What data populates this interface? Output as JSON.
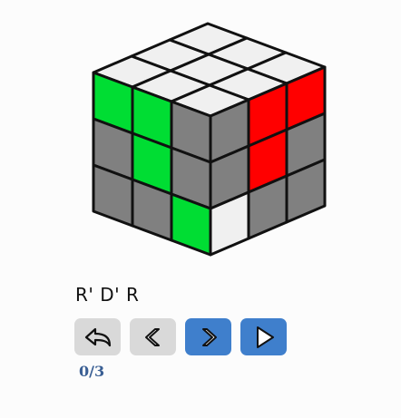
{
  "puzzle": {
    "faces": {
      "top": [
        [
          "white",
          "white",
          "white"
        ],
        [
          "white",
          "white",
          "white"
        ],
        [
          "white",
          "white",
          "white"
        ]
      ],
      "front": [
        [
          "green",
          "green",
          "gray"
        ],
        [
          "gray",
          "green",
          "gray"
        ],
        [
          "gray",
          "gray",
          "green"
        ]
      ],
      "right": [
        [
          "gray",
          "red",
          "red"
        ],
        [
          "gray",
          "red",
          "gray"
        ],
        [
          "white",
          "gray",
          "gray"
        ]
      ]
    },
    "colors": {
      "white": "#f0f0f0",
      "green": "#00dd33",
      "red": "#ff0000",
      "gray": "#808080",
      "edge": "#111111"
    }
  },
  "algorithm": "R' D' R",
  "controls": {
    "reset_icon": "undo-arrow-icon",
    "prev_icon": "chevron-left-icon",
    "next_icon": "chevron-right-icon",
    "play_icon": "play-triangle-icon"
  },
  "counter": "0/3",
  "accent": "#3f7fcc"
}
